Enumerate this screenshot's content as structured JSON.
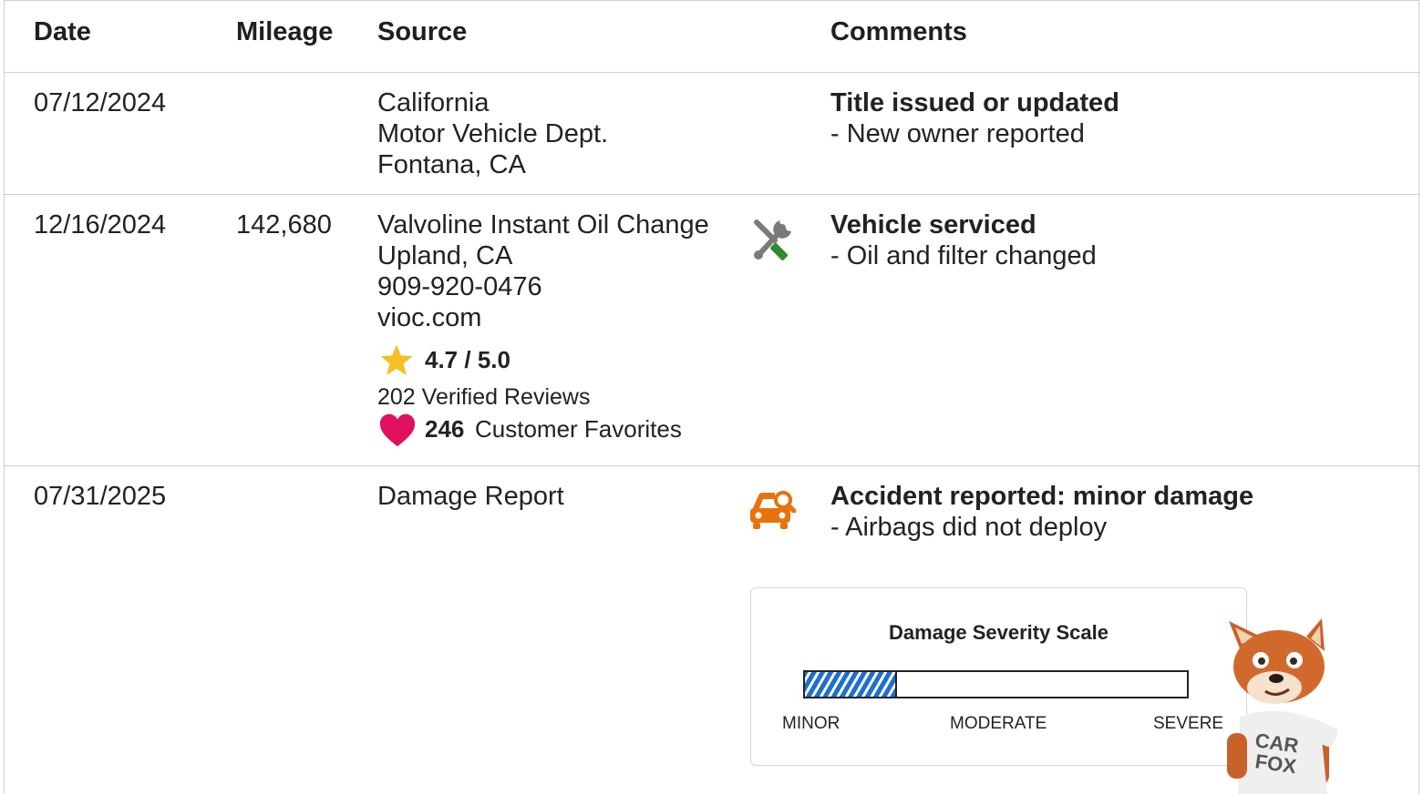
{
  "header": {
    "date": "Date",
    "mileage": "Mileage",
    "source": "Source",
    "comments": "Comments"
  },
  "rows": [
    {
      "date": "07/12/2024",
      "mileage": "",
      "source": [
        "California",
        "Motor Vehicle Dept.",
        "Fontana, CA"
      ],
      "comment_title": "Title issued or updated",
      "comment_detail": "- New owner reported"
    },
    {
      "date": "12/16/2024",
      "mileage": "142,680",
      "source": [
        "Valvoline Instant Oil Change",
        "Upland, CA",
        "909-920-0476",
        "vioc.com"
      ],
      "icon": "wrench-screwdriver-icon",
      "rating": "4.7 / 5.0",
      "reviews": "202 Verified Reviews",
      "favorites_count": "246",
      "favorites_label": "Customer Favorites",
      "comment_title": "Vehicle serviced",
      "comment_detail": "- Oil and filter changed"
    },
    {
      "date": "07/31/2025",
      "mileage": "",
      "source": [
        "Damage Report"
      ],
      "icon": "car-inspection-icon",
      "comment_title": "Accident reported: minor damage",
      "comment_detail": "- Airbags did not deploy"
    }
  ],
  "severity_scale": {
    "title": "Damage Severity Scale",
    "labels": [
      "MINOR",
      "MODERATE",
      "SEVERE"
    ],
    "level_fraction": 0.24
  },
  "mascot": {
    "shirt_text": [
      "CAR",
      "FOX"
    ]
  },
  "colors": {
    "star": "#f6bf26",
    "heart": "#e0105f",
    "car_icon": "#e8730c",
    "tool_handle": "#2e8b2e",
    "severity_fill": "#1f6fd1"
  }
}
